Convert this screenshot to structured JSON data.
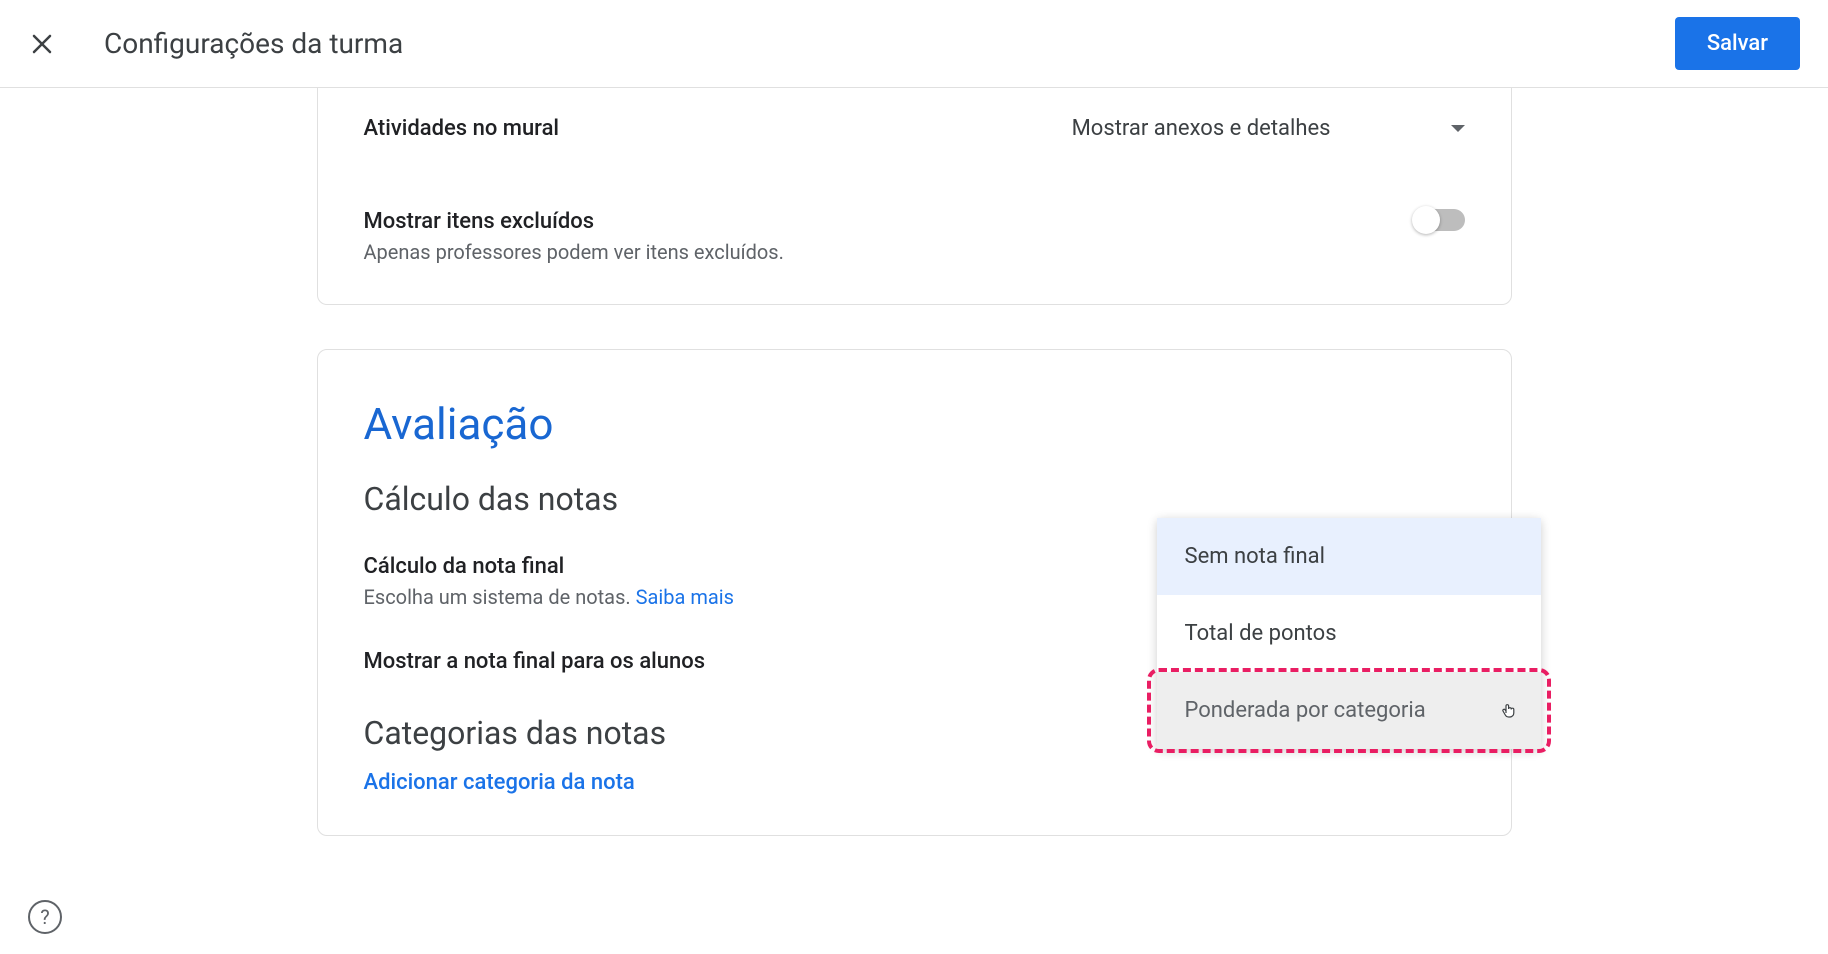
{
  "header": {
    "title": "Configurações da turma",
    "save_label": "Salvar"
  },
  "stream_card": {
    "activities_label": "Atividades no mural",
    "activities_value": "Mostrar anexos e detalhes",
    "deleted_label": "Mostrar itens excluídos",
    "deleted_description": "Apenas professores podem ver itens excluídos."
  },
  "grading_card": {
    "section_title": "Avaliação",
    "calc_subtitle": "Cálculo das notas",
    "final_calc_label": "Cálculo da nota final",
    "final_calc_description_prefix": "Escolha um sistema de notas. ",
    "final_calc_learn_more": "Saiba mais",
    "show_final_label": "Mostrar a nota final para os alunos",
    "categories_subtitle": "Categorias das notas",
    "add_category_label": "Adicionar categoria da nota"
  },
  "dropdown": {
    "options": {
      "none": "Sem nota final",
      "total": "Total de pontos",
      "weighted": "Ponderada por categoria"
    }
  }
}
